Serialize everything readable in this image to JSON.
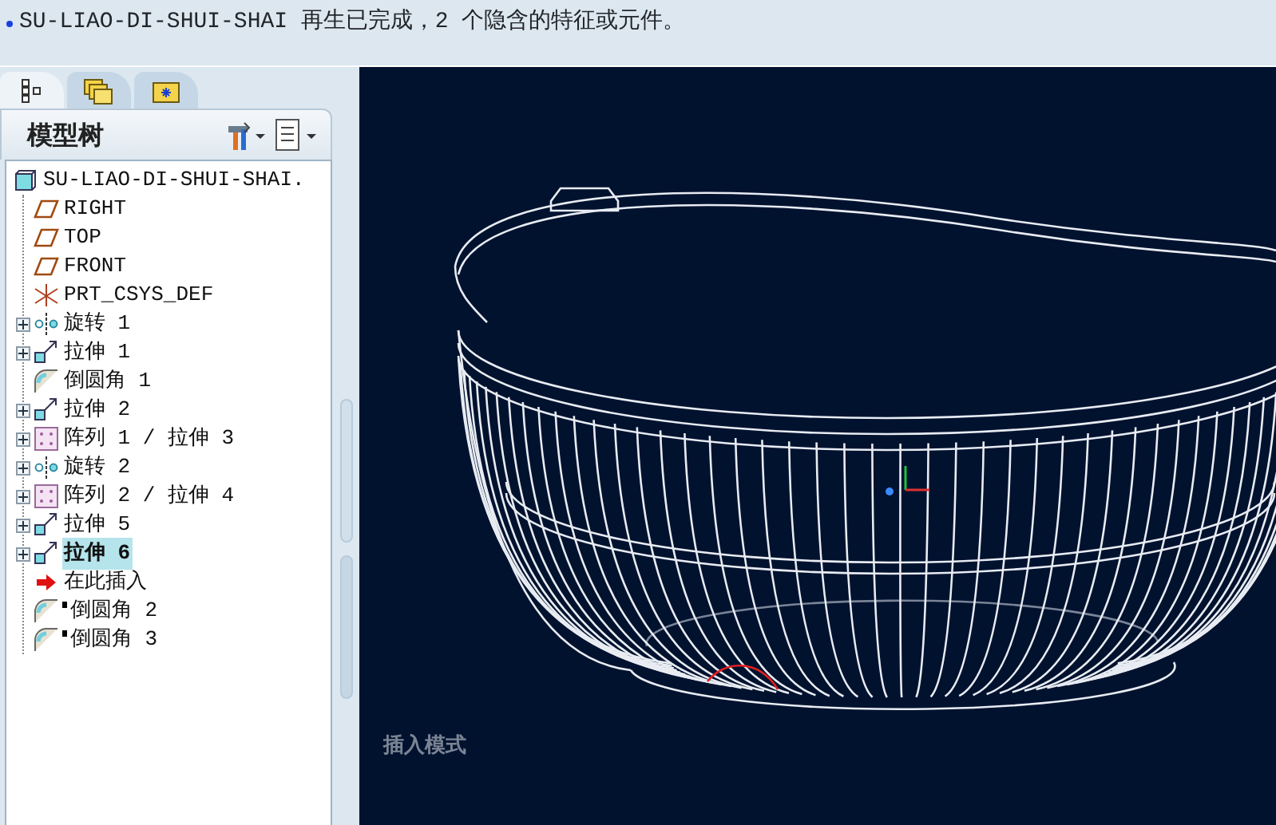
{
  "messages": [
    "SU-LIAO-DI-SHUI-SHAI 再生已完成，2 个隐含的特征或元件。"
  ],
  "tabs": [
    {
      "kind": "tree",
      "selected": true
    },
    {
      "kind": "folders",
      "selected": false
    },
    {
      "kind": "favorites",
      "selected": false
    }
  ],
  "panel": {
    "title": "模型树"
  },
  "tree": {
    "label": "SU-LIAO-DI-SHUI-SHAI.",
    "kind": "part",
    "children": [
      {
        "label": "RIGHT",
        "kind": "plane",
        "expandable": false,
        "selected": false,
        "after_insert": false
      },
      {
        "label": "TOP",
        "kind": "plane",
        "expandable": false,
        "selected": false,
        "after_insert": false
      },
      {
        "label": "FRONT",
        "kind": "plane",
        "expandable": false,
        "selected": false,
        "after_insert": false
      },
      {
        "label": "PRT_CSYS_DEF",
        "kind": "csys",
        "expandable": false,
        "selected": false,
        "after_insert": false
      },
      {
        "label": "旋转 1",
        "kind": "revolve",
        "expandable": true,
        "selected": false,
        "after_insert": false
      },
      {
        "label": "拉伸 1",
        "kind": "extrude",
        "expandable": true,
        "selected": false,
        "after_insert": false
      },
      {
        "label": "倒圆角 1",
        "kind": "round",
        "expandable": false,
        "selected": false,
        "after_insert": false
      },
      {
        "label": "拉伸 2",
        "kind": "extrude",
        "expandable": true,
        "selected": false,
        "after_insert": false
      },
      {
        "label": "阵列 1 / 拉伸 3",
        "kind": "pattern",
        "expandable": true,
        "selected": false,
        "after_insert": false
      },
      {
        "label": "旋转 2",
        "kind": "revolve",
        "expandable": true,
        "selected": false,
        "after_insert": false
      },
      {
        "label": "阵列 2 / 拉伸 4",
        "kind": "pattern",
        "expandable": true,
        "selected": false,
        "after_insert": false
      },
      {
        "label": "拉伸 5",
        "kind": "extrude",
        "expandable": true,
        "selected": false,
        "after_insert": false
      },
      {
        "label": "拉伸 6",
        "kind": "extrude",
        "expandable": true,
        "selected": true,
        "after_insert": false
      },
      {
        "label": "在此插入",
        "kind": "insert",
        "expandable": false,
        "selected": false,
        "after_insert": false
      },
      {
        "label": "倒圆角 2",
        "kind": "round",
        "expandable": false,
        "selected": false,
        "after_insert": true
      },
      {
        "label": "倒圆角 3",
        "kind": "round",
        "expandable": false,
        "selected": false,
        "after_insert": true
      }
    ]
  },
  "viewport": {
    "mode_label": "插入模式"
  }
}
